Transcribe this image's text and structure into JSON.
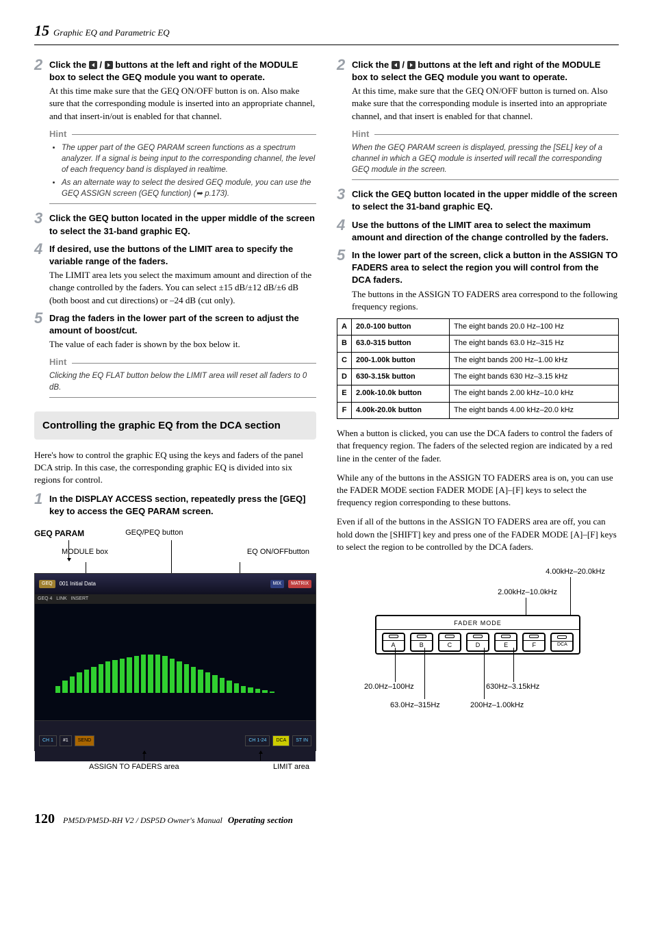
{
  "header": {
    "chapter_num": "15",
    "chapter_title": "Graphic EQ and Parametric EQ"
  },
  "left": {
    "step2": {
      "title_a": "Click the ",
      "title_b": " / ",
      "title_c": " buttons at the left and right of the MODULE box to select the GEQ module you want to operate.",
      "text": "At this time make sure that the GEQ ON/OFF button is on. Also make sure that the corresponding module is inserted into an appropriate channel, and that insert-in/out is enabled for that channel."
    },
    "hint1": {
      "label": "Hint",
      "items": [
        "The upper part of the GEQ PARAM screen functions as a spectrum analyzer. If a signal is being input to the corresponding channel, the level of each frequency band is displayed in realtime.",
        "As an alternate way to select the desired GEQ module, you can use the GEQ ASSIGN screen (GEQ function) (➥ p.173)."
      ]
    },
    "step3": {
      "title": "Click the GEQ button located in the upper middle of the screen to select the 31-band graphic EQ."
    },
    "step4": {
      "title": "If desired, use the buttons of the LIMIT area to specify the variable range of the faders.",
      "text": "The LIMIT area lets you select the maximum amount and direction of the change controlled by the faders. You can select ±15 dB/±12 dB/±6 dB (both boost and cut directions) or –24 dB (cut only)."
    },
    "step5": {
      "title": "Drag the faders in the lower part of the screen to adjust the amount of boost/cut.",
      "text": "The value of each fader is shown by the box below it."
    },
    "hint2": {
      "label": "Hint",
      "text": "Clicking the EQ FLAT button below the LIMIT area will reset all faders to 0 dB."
    },
    "section": "Controlling the graphic EQ from the DCA section",
    "section_intro": "Here's how to control the graphic EQ using the keys and faders of the panel DCA strip. In this case, the corresponding graphic EQ is divided into six regions for control.",
    "dca_step1": {
      "title": "In the DISPLAY ACCESS section, repeatedly press the [GEQ] key to access the GEQ PARAM screen."
    },
    "diagram": {
      "geq_param": "GEQ PARAM",
      "geq_peq_btn": "GEQ/PEQ button",
      "module_box": "MODULE box",
      "eq_onoff": "EQ ON/OFFbutton",
      "assign_area": "ASSIGN TO FADERS area",
      "limit_area": "LIMIT area"
    }
  },
  "right": {
    "step2": {
      "title_a": "Click the ",
      "title_b": " / ",
      "title_c": " buttons at the left and right of the MODULE box to select the GEQ module you want to operate.",
      "text": "At this time, make sure that the GEQ ON/OFF button is turned on. Also make sure that the corresponding module is inserted into an appropriate channel, and that insert is enabled for that channel."
    },
    "hint": {
      "label": "Hint",
      "text": "When the GEQ PARAM screen is displayed, pressing the [SEL] key of a channel in which a GEQ module is inserted will recall the corresponding GEQ module in the screen."
    },
    "step3": {
      "title": "Click the GEQ button located in the upper middle of the screen to select the 31-band graphic EQ."
    },
    "step4": {
      "title": "Use the buttons of the LIMIT area to select the maximum amount and direction of the change controlled by the faders."
    },
    "step5": {
      "title": "In the lower part of the screen, click a button in the ASSIGN TO FADERS area to select the region you will control from the DCA faders.",
      "text": "The buttons in the ASSIGN TO FADERS area correspond to the following frequency regions."
    },
    "table": [
      {
        "k": "A",
        "btn": "20.0-100 button",
        "desc": "The eight bands 20.0 Hz–100 Hz"
      },
      {
        "k": "B",
        "btn": "63.0-315 button",
        "desc": "The eight bands 63.0 Hz–315 Hz"
      },
      {
        "k": "C",
        "btn": "200-1.00k button",
        "desc": "The eight bands 200 Hz–1.00 kHz"
      },
      {
        "k": "D",
        "btn": "630-3.15k button",
        "desc": "The eight bands 630 Hz–3.15 kHz"
      },
      {
        "k": "E",
        "btn": "2.00k-10.0k button",
        "desc": "The eight bands 2.00 kHz–10.0 kHz"
      },
      {
        "k": "F",
        "btn": "4.00k-20.0k button",
        "desc": "The eight bands 4.00 kHz–20.0 kHz"
      }
    ],
    "para1": "When a button is clicked, you can use the DCA faders to control the faders of that frequency region. The faders of the selected region are indicated by a red line in the center of the fader.",
    "para2": "While any of the buttons in the ASSIGN TO FADERS area is on, you can use the FADER MODE section FADER MODE [A]–[F] keys to select the frequency region corresponding to these buttons.",
    "para3": "Even if all of the buttons in the ASSIGN TO FADERS area are off, you can hold down the [SHIFT] key and press one of the FADER MODE [A]–[F] keys to select the region to be controlled by the DCA faders.",
    "fader": {
      "title": "FADER MODE",
      "keys": [
        "A",
        "B",
        "C",
        "D",
        "E",
        "F",
        "DCA"
      ],
      "labels": {
        "a": "20.0Hz–100Hz",
        "b": "63.0Hz–315Hz",
        "c": "200Hz–1.00kHz",
        "d": "630Hz–3.15kHz",
        "e": "2.00kHz–10.0kHz",
        "f": "4.00kHz–20.0kHz"
      }
    }
  },
  "footer": {
    "page": "120",
    "manual": "PM5D/PM5D-RH V2 / DSP5D Owner's Manual",
    "section": "Operating section"
  }
}
